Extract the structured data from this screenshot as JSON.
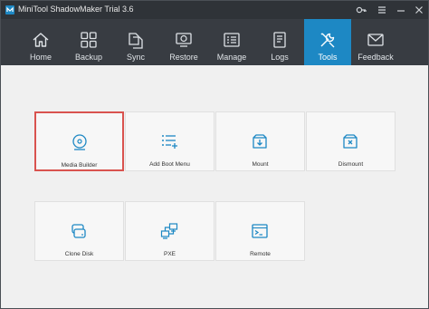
{
  "window": {
    "title": "MiniTool ShadowMaker Trial 3.6",
    "accent_color": "#1d88c4",
    "highlight_color": "#d9534f",
    "controls": [
      "key-icon",
      "menu-icon",
      "minimize-icon",
      "close-icon"
    ]
  },
  "toolbar": {
    "active": "Tools",
    "items": [
      {
        "label": "Home",
        "icon": "home-icon"
      },
      {
        "label": "Backup",
        "icon": "backup-icon"
      },
      {
        "label": "Sync",
        "icon": "sync-icon"
      },
      {
        "label": "Restore",
        "icon": "restore-icon"
      },
      {
        "label": "Manage",
        "icon": "manage-icon"
      },
      {
        "label": "Logs",
        "icon": "logs-icon"
      },
      {
        "label": "Tools",
        "icon": "tools-icon"
      },
      {
        "label": "Feedback",
        "icon": "feedback-icon"
      }
    ]
  },
  "tools": {
    "selected": "Media Builder",
    "tiles": [
      {
        "label": "Media Builder",
        "icon": "disc-user-icon"
      },
      {
        "label": "Add Boot Menu",
        "icon": "boot-menu-icon"
      },
      {
        "label": "Mount",
        "icon": "mount-icon"
      },
      {
        "label": "Dismount",
        "icon": "dismount-icon"
      },
      {
        "label": "Clone Disk",
        "icon": "clone-disk-icon"
      },
      {
        "label": "PXE",
        "icon": "pxe-icon"
      },
      {
        "label": "Remote",
        "icon": "remote-icon"
      }
    ]
  }
}
